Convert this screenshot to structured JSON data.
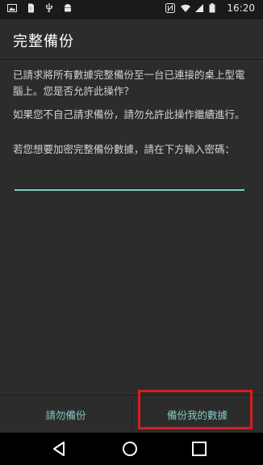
{
  "status_bar": {
    "time": "16:20",
    "icons": [
      "gallery-icon",
      "sim-icon",
      "usb-icon",
      "android-icon",
      "nfc-icon",
      "wifi-icon",
      "signal-icon",
      "battery-icon"
    ]
  },
  "dialog": {
    "title": "完整備份",
    "paragraph1": "已請求將所有數據完整備份至一台已連接的桌上型電腦上。您是否允許此操作？",
    "paragraph2": "如果您不自己請求備份，請勿允許此操作繼續進行。",
    "paragraph3": "若您想要加密完整備份數據，請在下方輸入密碼：",
    "password_value": "",
    "deny_label": "請勿備份",
    "allow_label": "備份我的數據"
  },
  "colors": {
    "accent": "#80cbc4",
    "highlight": "#d71e1e",
    "background": "#2c2c2c"
  }
}
